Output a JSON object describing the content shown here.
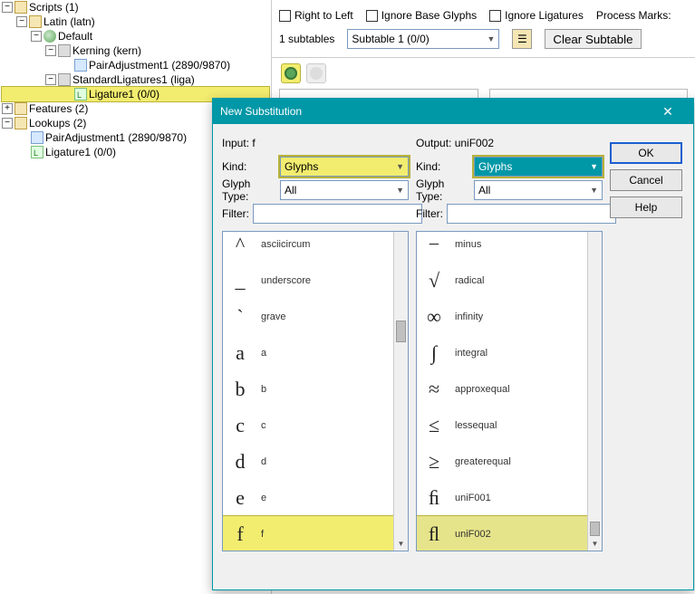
{
  "tree": {
    "scripts_label": "Scripts (1)",
    "latin_label": "Latin (latn)",
    "default_label": "Default",
    "kerning_label": "Kerning (kern)",
    "pairadj_label": "PairAdjustment1 (2890/9870)",
    "stdlig_label": "StandardLigatures1 (liga)",
    "lig1_label": "Ligature1 (0/0)",
    "features_label": "Features (2)",
    "lookups_label": "Lookups (2)",
    "lk_pairadj_label": "PairAdjustment1 (2890/9870)",
    "lk_lig1_label": "Ligature1 (0/0)"
  },
  "toolbar": {
    "rtl": "Right to Left",
    "ignore_base": "Ignore Base Glyphs",
    "ignore_lig": "Ignore Ligatures",
    "process_marks": "Process Marks:",
    "subtables_label": "1 subtables",
    "subtable_current": "Subtable 1 (0/0)",
    "clear": "Clear Subtable"
  },
  "dialog": {
    "title": "New Substitution",
    "input_header": "Input: f",
    "output_header": "Output: uniF002",
    "kind_label": "Kind:",
    "glyphtype_label": "Glyph Type:",
    "filter_label": "Filter:",
    "kind_value": "Glyphs",
    "glyphtype_value": "All",
    "buttons": {
      "ok": "OK",
      "cancel": "Cancel",
      "help": "Help"
    },
    "input_glyphs": [
      {
        "sym": "^",
        "name": "asciicircum"
      },
      {
        "sym": "_",
        "name": "underscore"
      },
      {
        "sym": "`",
        "name": "grave"
      },
      {
        "sym": "a",
        "name": "a"
      },
      {
        "sym": "b",
        "name": "b"
      },
      {
        "sym": "c",
        "name": "c"
      },
      {
        "sym": "d",
        "name": "d"
      },
      {
        "sym": "e",
        "name": "e"
      },
      {
        "sym": "f",
        "name": "f"
      }
    ],
    "output_glyphs": [
      {
        "sym": "−",
        "name": "minus"
      },
      {
        "sym": "√",
        "name": "radical"
      },
      {
        "sym": "∞",
        "name": "infinity"
      },
      {
        "sym": "∫",
        "name": "integral"
      },
      {
        "sym": "≈",
        "name": "approxequal"
      },
      {
        "sym": "≤",
        "name": "lessequal"
      },
      {
        "sym": "≥",
        "name": "greaterequal"
      },
      {
        "sym": "ﬁ",
        "name": "uniF001"
      },
      {
        "sym": "ﬂ",
        "name": "uniF002"
      }
    ],
    "input_selected_index": 8,
    "output_selected_index": 8
  }
}
